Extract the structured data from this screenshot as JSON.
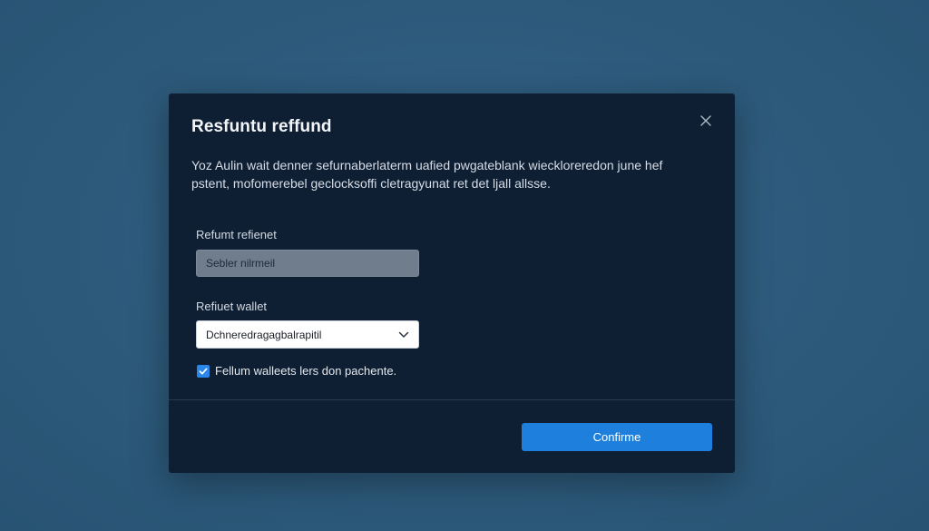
{
  "dialog": {
    "title": "Resfuntu reffund",
    "description": "Yoz Aulin wait denner sefurnaberlaterm uafied pwgateblank wieckloreredon june hef pstent, mofomerebel geclocksoffi cletragyunat ret det ljall allsse.",
    "close_icon": "close-icon"
  },
  "form": {
    "refund_label": "Refumt refienet",
    "refund_placeholder": "Sebler nilrmeil",
    "wallet_label": "Refiuet wallet",
    "wallet_selected": "Dchneredragagbalrapitil",
    "dropdown_icon": "chevron-down-icon",
    "checkbox_label": "Fellum walleets lers don pachente.",
    "checkbox_checked": true
  },
  "footer": {
    "confirm_label": "Confirme"
  },
  "colors": {
    "background": "#2e5b7c",
    "dialog": "#0f1f33",
    "accent": "#1f7fdc"
  }
}
